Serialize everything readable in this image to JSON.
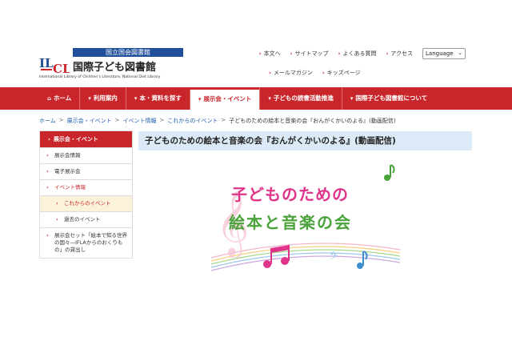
{
  "header": {
    "logo_top": "国立国会図書館",
    "logo_title": "国際子ども図書館",
    "logo_en": "International Library of Children's Literature, National Diet Library",
    "logo_mark": "ILCL"
  },
  "utility": {
    "links": [
      "本文へ",
      "サイトマップ",
      "よくある質問",
      "アクセス"
    ],
    "language": "Language",
    "links2": [
      "メールマガジン",
      "キッズページ"
    ]
  },
  "nav": {
    "items": [
      "ホーム",
      "利用案内",
      "本・資料を探す",
      "展示会・イベント",
      "子どもの読書活動推進",
      "国際子ども図書館について"
    ],
    "active_index": 3,
    "color": "#c8262b"
  },
  "breadcrumb": {
    "items": [
      "ホーム",
      "展示会・イベント",
      "イベント情報",
      "これからのイベント"
    ],
    "current": "子どものための絵本と音楽の会『おんがくかいのよる』(動画配信)"
  },
  "sidebar": {
    "head": "展示会・イベント",
    "items": [
      {
        "label": "展示会情報"
      },
      {
        "label": "電子展示会"
      },
      {
        "label": "イベント情報"
      },
      {
        "label": "これからのイベント"
      },
      {
        "label": "過去のイベント"
      },
      {
        "label": "展示会セット「絵本で知る世界の国々―IFLAからのおくりもの」の貸出し"
      }
    ]
  },
  "main": {
    "title": "子どものための絵本と音楽の会『おんがくかいのよる』(動画配信)",
    "banner_line1": "子どものための",
    "banner_line2": "絵本と音楽の会"
  }
}
